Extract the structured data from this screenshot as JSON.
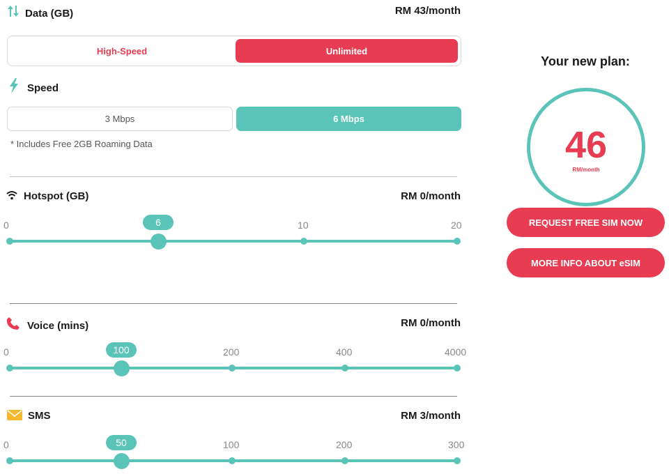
{
  "data_section": {
    "title": "Data (GB)",
    "price": "RM 43/month",
    "icon": "data-transfer-icon",
    "options": [
      "High-Speed",
      "Unlimited"
    ],
    "selected": "Unlimited"
  },
  "speed_section": {
    "title": "Speed",
    "icon": "lightning-icon",
    "options": [
      "3 Mbps",
      "6 Mbps"
    ],
    "selected": "6 Mbps",
    "note": "* Includes Free 2GB Roaming Data"
  },
  "hotspot": {
    "title": "Hotspot (GB)",
    "price": "RM 0/month",
    "icon": "wifi-icon",
    "ticks": [
      "0",
      "10",
      "20"
    ],
    "value": "6"
  },
  "voice": {
    "title": "Voice (mins)",
    "price": "RM 0/month",
    "icon": "phone-icon",
    "ticks": [
      "0",
      "200",
      "400",
      "4000"
    ],
    "value": "100"
  },
  "sms": {
    "title": "SMS",
    "price": "RM 3/month",
    "icon": "envelope-icon",
    "ticks": [
      "0",
      "100",
      "200",
      "300"
    ],
    "value": "50"
  },
  "plan": {
    "title": "Your new plan:",
    "amount": "46",
    "unit": "RM/month"
  },
  "buttons": {
    "request_sim": "REQUEST FREE SIM NOW",
    "more_info": "MORE INFO ABOUT eSIM"
  },
  "colors": {
    "accent_red": "#e83c52",
    "accent_teal": "#5bc4b8",
    "sms_icon_yellow": "#f5b82e"
  }
}
